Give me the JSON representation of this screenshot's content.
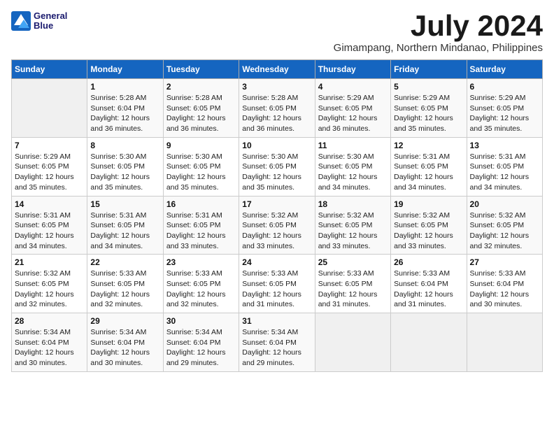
{
  "logo": {
    "line1": "General",
    "line2": "Blue"
  },
  "title": "July 2024",
  "location": "Gimampang, Northern Mindanao, Philippines",
  "days_of_week": [
    "Sunday",
    "Monday",
    "Tuesday",
    "Wednesday",
    "Thursday",
    "Friday",
    "Saturday"
  ],
  "weeks": [
    [
      {
        "day": "",
        "sunrise": "",
        "sunset": "",
        "daylight": ""
      },
      {
        "day": "1",
        "sunrise": "Sunrise: 5:28 AM",
        "sunset": "Sunset: 6:04 PM",
        "daylight": "Daylight: 12 hours and 36 minutes."
      },
      {
        "day": "2",
        "sunrise": "Sunrise: 5:28 AM",
        "sunset": "Sunset: 6:05 PM",
        "daylight": "Daylight: 12 hours and 36 minutes."
      },
      {
        "day": "3",
        "sunrise": "Sunrise: 5:28 AM",
        "sunset": "Sunset: 6:05 PM",
        "daylight": "Daylight: 12 hours and 36 minutes."
      },
      {
        "day": "4",
        "sunrise": "Sunrise: 5:29 AM",
        "sunset": "Sunset: 6:05 PM",
        "daylight": "Daylight: 12 hours and 36 minutes."
      },
      {
        "day": "5",
        "sunrise": "Sunrise: 5:29 AM",
        "sunset": "Sunset: 6:05 PM",
        "daylight": "Daylight: 12 hours and 35 minutes."
      },
      {
        "day": "6",
        "sunrise": "Sunrise: 5:29 AM",
        "sunset": "Sunset: 6:05 PM",
        "daylight": "Daylight: 12 hours and 35 minutes."
      }
    ],
    [
      {
        "day": "7",
        "sunrise": "Sunrise: 5:29 AM",
        "sunset": "Sunset: 6:05 PM",
        "daylight": "Daylight: 12 hours and 35 minutes."
      },
      {
        "day": "8",
        "sunrise": "Sunrise: 5:30 AM",
        "sunset": "Sunset: 6:05 PM",
        "daylight": "Daylight: 12 hours and 35 minutes."
      },
      {
        "day": "9",
        "sunrise": "Sunrise: 5:30 AM",
        "sunset": "Sunset: 6:05 PM",
        "daylight": "Daylight: 12 hours and 35 minutes."
      },
      {
        "day": "10",
        "sunrise": "Sunrise: 5:30 AM",
        "sunset": "Sunset: 6:05 PM",
        "daylight": "Daylight: 12 hours and 35 minutes."
      },
      {
        "day": "11",
        "sunrise": "Sunrise: 5:30 AM",
        "sunset": "Sunset: 6:05 PM",
        "daylight": "Daylight: 12 hours and 34 minutes."
      },
      {
        "day": "12",
        "sunrise": "Sunrise: 5:31 AM",
        "sunset": "Sunset: 6:05 PM",
        "daylight": "Daylight: 12 hours and 34 minutes."
      },
      {
        "day": "13",
        "sunrise": "Sunrise: 5:31 AM",
        "sunset": "Sunset: 6:05 PM",
        "daylight": "Daylight: 12 hours and 34 minutes."
      }
    ],
    [
      {
        "day": "14",
        "sunrise": "Sunrise: 5:31 AM",
        "sunset": "Sunset: 6:05 PM",
        "daylight": "Daylight: 12 hours and 34 minutes."
      },
      {
        "day": "15",
        "sunrise": "Sunrise: 5:31 AM",
        "sunset": "Sunset: 6:05 PM",
        "daylight": "Daylight: 12 hours and 34 minutes."
      },
      {
        "day": "16",
        "sunrise": "Sunrise: 5:31 AM",
        "sunset": "Sunset: 6:05 PM",
        "daylight": "Daylight: 12 hours and 33 minutes."
      },
      {
        "day": "17",
        "sunrise": "Sunrise: 5:32 AM",
        "sunset": "Sunset: 6:05 PM",
        "daylight": "Daylight: 12 hours and 33 minutes."
      },
      {
        "day": "18",
        "sunrise": "Sunrise: 5:32 AM",
        "sunset": "Sunset: 6:05 PM",
        "daylight": "Daylight: 12 hours and 33 minutes."
      },
      {
        "day": "19",
        "sunrise": "Sunrise: 5:32 AM",
        "sunset": "Sunset: 6:05 PM",
        "daylight": "Daylight: 12 hours and 33 minutes."
      },
      {
        "day": "20",
        "sunrise": "Sunrise: 5:32 AM",
        "sunset": "Sunset: 6:05 PM",
        "daylight": "Daylight: 12 hours and 32 minutes."
      }
    ],
    [
      {
        "day": "21",
        "sunrise": "Sunrise: 5:32 AM",
        "sunset": "Sunset: 6:05 PM",
        "daylight": "Daylight: 12 hours and 32 minutes."
      },
      {
        "day": "22",
        "sunrise": "Sunrise: 5:33 AM",
        "sunset": "Sunset: 6:05 PM",
        "daylight": "Daylight: 12 hours and 32 minutes."
      },
      {
        "day": "23",
        "sunrise": "Sunrise: 5:33 AM",
        "sunset": "Sunset: 6:05 PM",
        "daylight": "Daylight: 12 hours and 32 minutes."
      },
      {
        "day": "24",
        "sunrise": "Sunrise: 5:33 AM",
        "sunset": "Sunset: 6:05 PM",
        "daylight": "Daylight: 12 hours and 31 minutes."
      },
      {
        "day": "25",
        "sunrise": "Sunrise: 5:33 AM",
        "sunset": "Sunset: 6:05 PM",
        "daylight": "Daylight: 12 hours and 31 minutes."
      },
      {
        "day": "26",
        "sunrise": "Sunrise: 5:33 AM",
        "sunset": "Sunset: 6:04 PM",
        "daylight": "Daylight: 12 hours and 31 minutes."
      },
      {
        "day": "27",
        "sunrise": "Sunrise: 5:33 AM",
        "sunset": "Sunset: 6:04 PM",
        "daylight": "Daylight: 12 hours and 30 minutes."
      }
    ],
    [
      {
        "day": "28",
        "sunrise": "Sunrise: 5:34 AM",
        "sunset": "Sunset: 6:04 PM",
        "daylight": "Daylight: 12 hours and 30 minutes."
      },
      {
        "day": "29",
        "sunrise": "Sunrise: 5:34 AM",
        "sunset": "Sunset: 6:04 PM",
        "daylight": "Daylight: 12 hours and 30 minutes."
      },
      {
        "day": "30",
        "sunrise": "Sunrise: 5:34 AM",
        "sunset": "Sunset: 6:04 PM",
        "daylight": "Daylight: 12 hours and 29 minutes."
      },
      {
        "day": "31",
        "sunrise": "Sunrise: 5:34 AM",
        "sunset": "Sunset: 6:04 PM",
        "daylight": "Daylight: 12 hours and 29 minutes."
      },
      {
        "day": "",
        "sunrise": "",
        "sunset": "",
        "daylight": ""
      },
      {
        "day": "",
        "sunrise": "",
        "sunset": "",
        "daylight": ""
      },
      {
        "day": "",
        "sunrise": "",
        "sunset": "",
        "daylight": ""
      }
    ]
  ]
}
